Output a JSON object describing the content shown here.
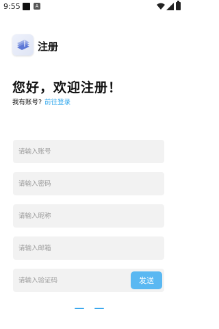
{
  "status_bar": {
    "time": "9:55",
    "notification_letter": "A"
  },
  "header": {
    "title": "注册"
  },
  "welcome": {
    "headline": "您好，欢迎注册！",
    "has_account_text": "我有账号?",
    "login_link": "前往登录"
  },
  "form": {
    "fields": [
      {
        "placeholder": "请输入账号",
        "value": ""
      },
      {
        "placeholder": "请输入密码",
        "value": ""
      },
      {
        "placeholder": "请输入昵称",
        "value": ""
      },
      {
        "placeholder": "请输入邮箱",
        "value": ""
      },
      {
        "placeholder": "请输入验证码",
        "value": ""
      }
    ],
    "send_button": "发送"
  },
  "colors": {
    "accent": "#2fa6ec",
    "button": "#5ab8f2",
    "field_bg": "#f2f2f2"
  }
}
